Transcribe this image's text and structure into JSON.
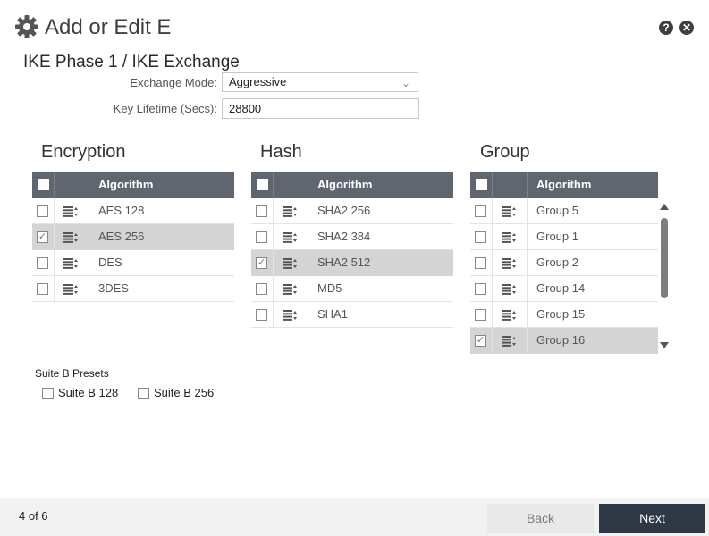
{
  "header": {
    "title": "Add or Edit E",
    "help_glyph": "?",
    "close_glyph": "✕"
  },
  "section_title": "IKE Phase 1 / IKE Exchange",
  "form": {
    "exchange_mode_label": "Exchange Mode:",
    "exchange_mode_value": "Aggressive",
    "key_lifetime_label": "Key Lifetime (Secs):",
    "key_lifetime_value": "28800"
  },
  "grids": [
    {
      "title": "Encryption",
      "column": "Algorithm",
      "rows": [
        {
          "label": "AES 128",
          "checked": false
        },
        {
          "label": "AES 256",
          "checked": true
        },
        {
          "label": "DES",
          "checked": false
        },
        {
          "label": "3DES",
          "checked": false
        }
      ]
    },
    {
      "title": "Hash",
      "column": "Algorithm",
      "rows": [
        {
          "label": "SHA2 256",
          "checked": false
        },
        {
          "label": "SHA2 384",
          "checked": false
        },
        {
          "label": "SHA2 512",
          "checked": true
        },
        {
          "label": "MD5",
          "checked": false
        },
        {
          "label": "SHA1",
          "checked": false
        }
      ]
    },
    {
      "title": "Group",
      "column": "Algorithm",
      "rows": [
        {
          "label": "Group 5",
          "checked": false
        },
        {
          "label": "Group 1",
          "checked": false
        },
        {
          "label": "Group 2",
          "checked": false
        },
        {
          "label": "Group 14",
          "checked": false
        },
        {
          "label": "Group 15",
          "checked": false
        },
        {
          "label": "Group 16",
          "checked": true
        }
      ]
    }
  ],
  "suite_b": {
    "label": "Suite B Presets",
    "options": [
      {
        "label": "Suite B 128",
        "checked": false
      },
      {
        "label": "Suite B 256",
        "checked": false
      }
    ]
  },
  "footer": {
    "step": "4 of 6",
    "back_label": "Back",
    "next_label": "Next"
  },
  "colors": {
    "header_bg": "#5f6670",
    "selected_row": "#d4d4d4",
    "next_bg": "#2e3945",
    "footer_bg": "#f2f2f2"
  }
}
